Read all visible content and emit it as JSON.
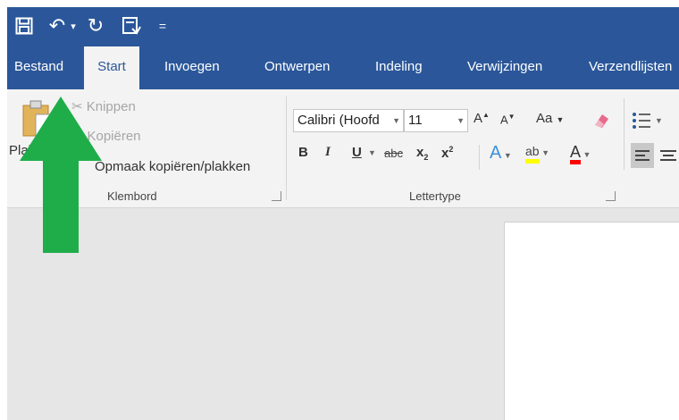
{
  "quick_access": {
    "save_icon": "save-icon",
    "undo_icon": "undo-icon",
    "undo_glyph": "↶",
    "undo_dropdown_glyph": "▾",
    "redo_icon": "redo-icon",
    "redo_glyph": "↻",
    "layout_icon": "print-layout-icon",
    "customize_glyph": "="
  },
  "tabs": [
    {
      "label": "Bestand",
      "active": false
    },
    {
      "label": "Start",
      "active": true
    },
    {
      "label": "Invoegen",
      "active": false
    },
    {
      "label": "Ontwerpen",
      "active": false
    },
    {
      "label": "Indeling",
      "active": false
    },
    {
      "label": "Verwijzingen",
      "active": false
    },
    {
      "label": "Verzendlijsten",
      "active": false
    }
  ],
  "clipboard": {
    "paste_label": "Plak",
    "cut_label": "Knippen",
    "copy_label": "Kopiëren",
    "format_painter_label": "Opmaak kopiëren/plakken",
    "group_label": "Klembord"
  },
  "font": {
    "font_name": "Calibri (Hoofd",
    "font_size": "11",
    "grow_label": "A",
    "shrink_label": "A",
    "case_label": "Aa",
    "bold_label": "B",
    "italic_label": "I",
    "underline_label": "U",
    "strike_label": "abc",
    "subscript_label": "x",
    "subscript_mark": "2",
    "superscript_label": "x",
    "superscript_mark": "2",
    "effects_label": "A",
    "highlight_label": "ab",
    "font_color_label": "A",
    "group_label": "Lettertype"
  },
  "colors": {
    "brand": "#2b579a",
    "ribbon_bg": "#f3f3f3",
    "canvas_bg": "#e6e6e6",
    "arrow": "#1fad4a",
    "highlight": "#ffff00",
    "font_color": "#ff0000",
    "effects": "#3b8fd8"
  }
}
